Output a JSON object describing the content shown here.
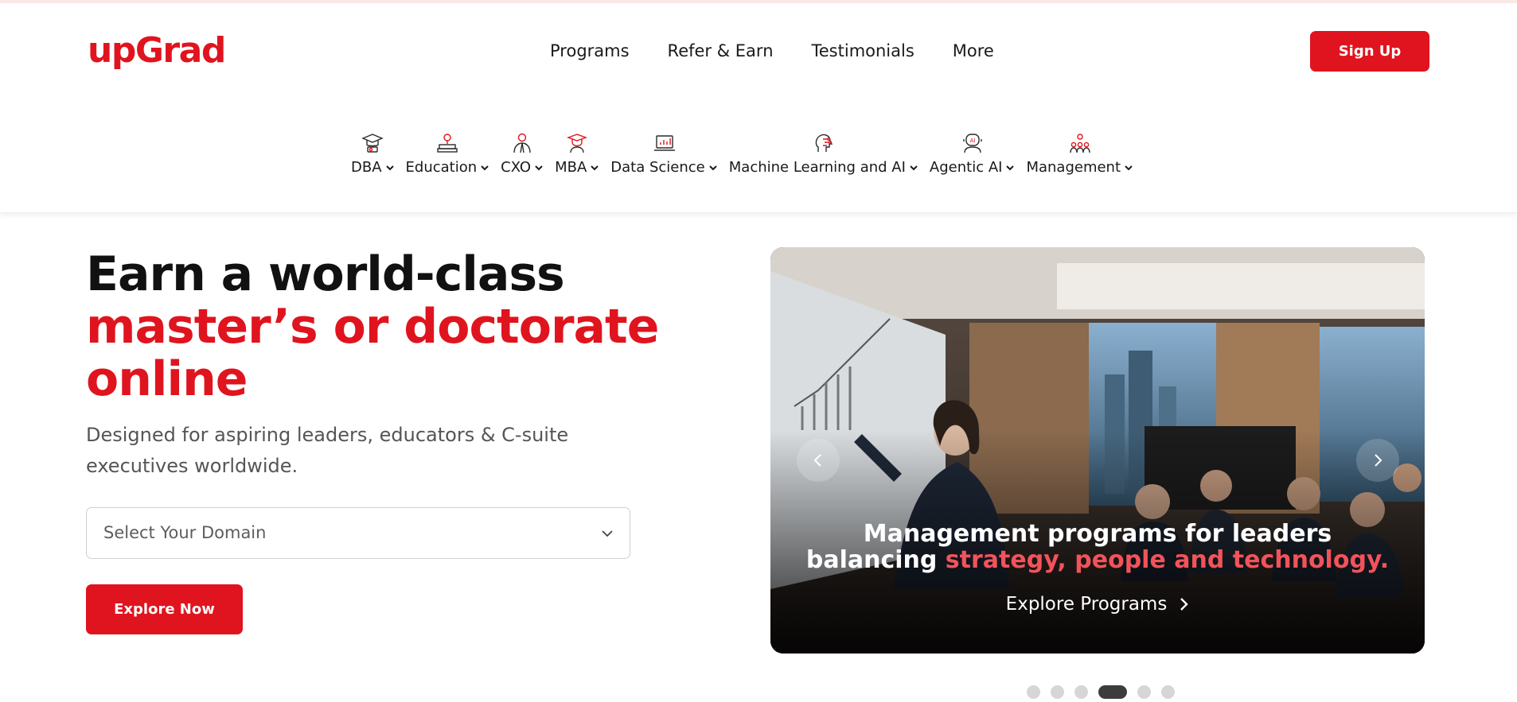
{
  "header": {
    "logo": "upGrad",
    "nav": [
      "Programs",
      "Refer & Earn",
      "Testimonials",
      "More"
    ],
    "signup_label": "Sign Up"
  },
  "categories": [
    {
      "label": "DBA",
      "icon": "graduation-cap-icon"
    },
    {
      "label": "Education",
      "icon": "education-icon"
    },
    {
      "label": "CXO",
      "icon": "executive-icon"
    },
    {
      "label": "MBA",
      "icon": "mba-cap-icon"
    },
    {
      "label": "Data Science",
      "icon": "laptop-chart-icon"
    },
    {
      "label": "Machine Learning and AI",
      "icon": "circuit-head-icon"
    },
    {
      "label": "Agentic AI",
      "icon": "robot-icon"
    },
    {
      "label": "Management",
      "icon": "team-icon"
    }
  ],
  "hero": {
    "line1": "Earn a world-class",
    "line2": "master’s or doctorate",
    "line3": "online",
    "subtitle": "Designed for aspiring leaders, educators & C-suite executives worldwide.",
    "select_placeholder": "Select Your Domain",
    "explore_label": "Explore Now"
  },
  "banner": {
    "caption_line1": "Management programs for leaders",
    "caption_line2_prefix": "balancing ",
    "caption_line2_highlight": "strategy, people and technology.",
    "link_label": "Explore Programs",
    "slide_count": 6,
    "active_slide": 4
  },
  "colors": {
    "brand": "#e0141e",
    "highlight": "#f2535a",
    "dot_active": "#3c3c3c",
    "dot_inactive": "#d6d6d6"
  }
}
